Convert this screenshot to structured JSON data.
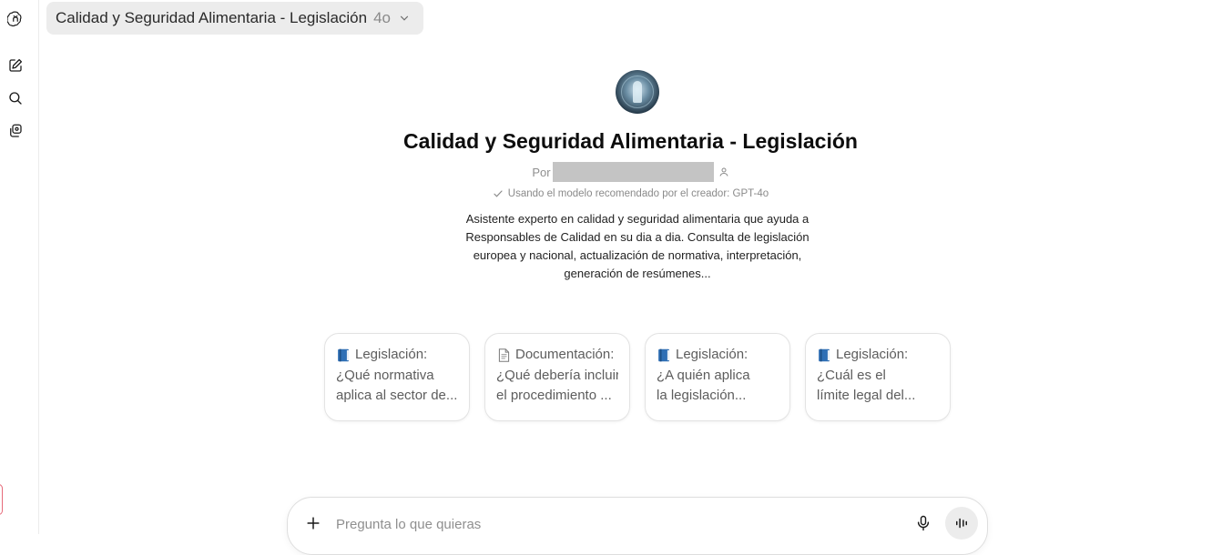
{
  "header": {
    "model_selector": {
      "name": "Calidad y Seguridad Alimentaria - Legislación",
      "version": "4o"
    }
  },
  "sidebar": {
    "icons": [
      "openai-logo-icon",
      "new-chat-icon",
      "search-icon",
      "library-icon"
    ]
  },
  "gpt": {
    "title": "Calidad y Seguridad Alimentaria - Legislación",
    "by_prefix": "Por",
    "model_note": "Usando el modelo recomendado por el creador: GPT-4o",
    "description": "Asistente experto en calidad y seguridad alimentaria que ayuda a Responsables de Calidad en su dia a dia. Consulta de legislación europea y nacional, actualización de normativa, interpretación, generación de resúmenes..."
  },
  "suggestions": [
    {
      "icon": "blue-book-icon",
      "category": "Legislación:",
      "line1": "¿Qué normativa",
      "line2": "aplica al sector de..."
    },
    {
      "icon": "document-icon",
      "category": "Documentación:",
      "line1": "¿Qué debería incluir",
      "line2": "el procedimiento ..."
    },
    {
      "icon": "blue-book-icon",
      "category": "Legislación:",
      "line1": "¿A quién aplica",
      "line2": "la legislación..."
    },
    {
      "icon": "blue-book-icon",
      "category": "Legislación:",
      "line1": "¿Cuál es el",
      "line2": "límite legal del..."
    }
  ],
  "composer": {
    "placeholder": "Pregunta lo que quieras"
  },
  "colors": {
    "pill_bg": "#ececec",
    "card_border": "#e3e3e3",
    "book_blue": "#2f6fb5",
    "muted_text": "#8f8f8f"
  }
}
